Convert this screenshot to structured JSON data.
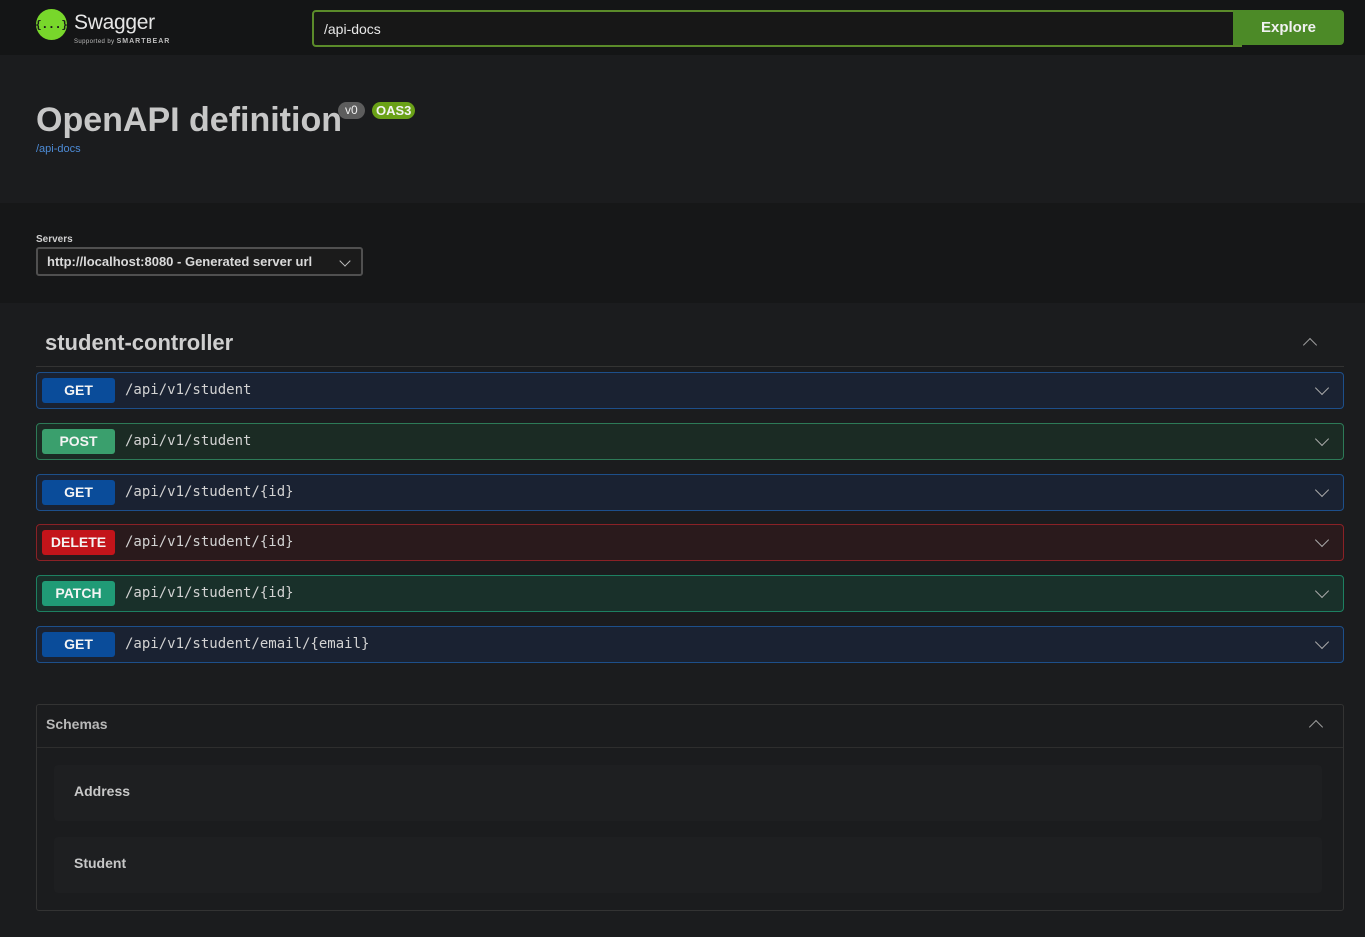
{
  "header": {
    "logo_name": "Swagger",
    "logo_sub_prefix": "Supported by",
    "logo_sub_brand": "SMARTBEAR",
    "logo_glyph": "{...}",
    "url_value": "/api-docs",
    "explore_label": "Explore"
  },
  "info": {
    "title": "OpenAPI definition",
    "version_badge": "v0",
    "oas_badge": "OAS3",
    "link": "/api-docs"
  },
  "servers": {
    "label": "Servers",
    "selected": "http://localhost:8080 - Generated server url"
  },
  "section": {
    "title": "student-controller",
    "operations": [
      {
        "method": "GET",
        "path": "/api/v1/student"
      },
      {
        "method": "POST",
        "path": "/api/v1/student"
      },
      {
        "method": "GET",
        "path": "/api/v1/student/{id}"
      },
      {
        "method": "DELETE",
        "path": "/api/v1/student/{id}"
      },
      {
        "method": "PATCH",
        "path": "/api/v1/student/{id}"
      },
      {
        "method": "GET",
        "path": "/api/v1/student/email/{email}"
      }
    ]
  },
  "schemas": {
    "title": "Schemas",
    "models": [
      "Address",
      "Student"
    ]
  },
  "colors": {
    "get": "#0a4c9a",
    "post": "#3a9f6d",
    "delete": "#c3141a",
    "patch": "#209b76",
    "brand": "#78d72b"
  }
}
